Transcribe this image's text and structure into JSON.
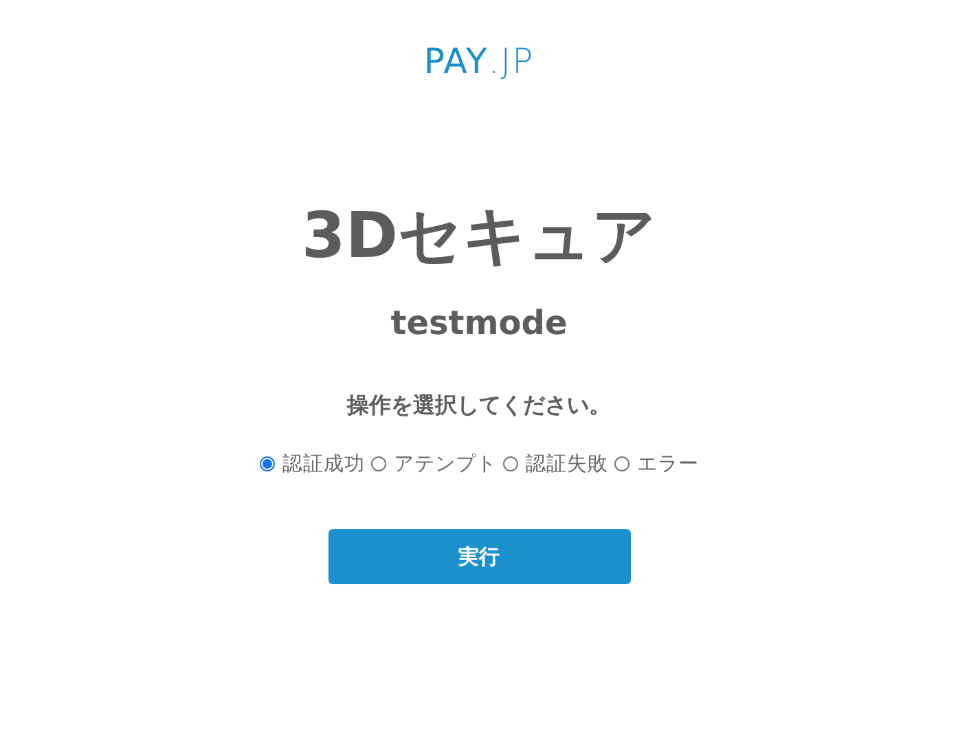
{
  "logo": "**PAY**.JP",
  "title": "3Dセキュア",
  "subtitle": "testmode",
  "prompt": "操作を選択してください。",
  "options": [
    {
      "label": "認証成功",
      "selected": true
    },
    {
      "label": "アテンプト",
      "selected": false
    },
    {
      "label": "認証失敗",
      "selected": false
    },
    {
      "label": "エラー",
      "selected": false
    }
  ],
  "submit": "実行"
}
